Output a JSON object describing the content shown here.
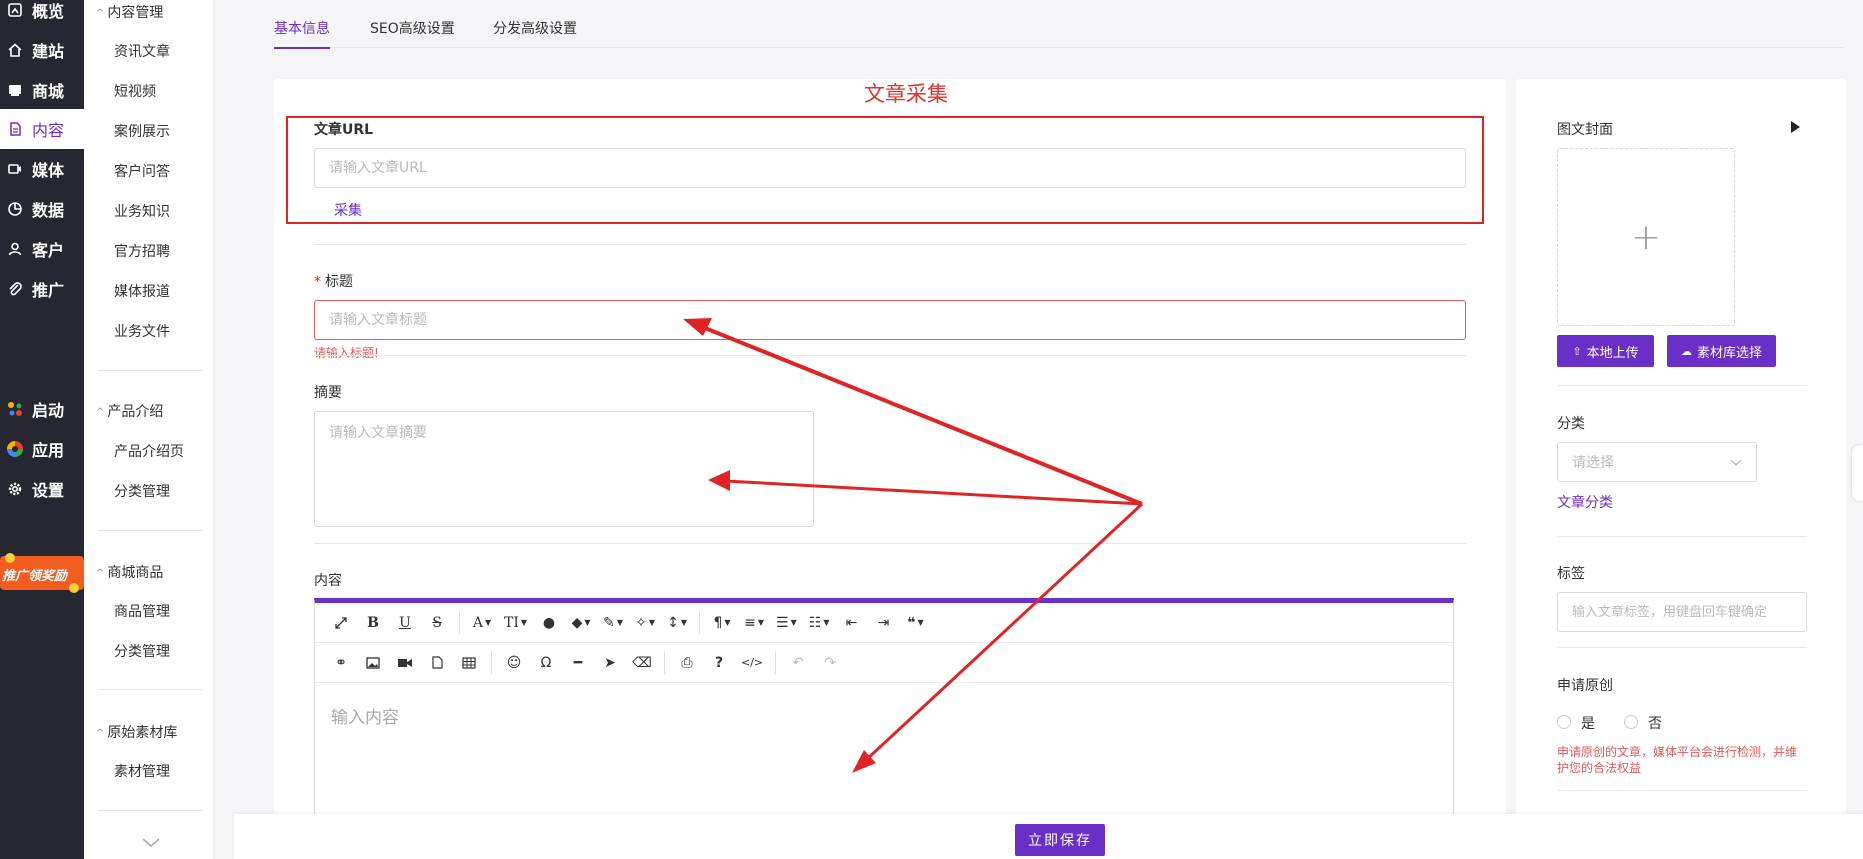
{
  "dark_nav": {
    "items": [
      {
        "label": "概览",
        "icon": "dashboard-icon"
      },
      {
        "label": "建站",
        "icon": "home-icon"
      },
      {
        "label": "商城",
        "icon": "shop-icon"
      },
      {
        "label": "内容",
        "icon": "document-icon",
        "active": true
      },
      {
        "label": "媒体",
        "icon": "video-icon"
      },
      {
        "label": "数据",
        "icon": "pie-chart-icon"
      },
      {
        "label": "客户",
        "icon": "user-icon"
      },
      {
        "label": "推广",
        "icon": "paperclip-icon"
      },
      {
        "label": "启动",
        "icon": "launch-icon"
      },
      {
        "label": "应用",
        "icon": "apps-icon"
      },
      {
        "label": "设置",
        "icon": "gear-icon"
      }
    ],
    "promo_text": "推广领奖励"
  },
  "sub_nav": {
    "groups": [
      {
        "title": "内容管理",
        "items": [
          "资讯文章",
          "短视频",
          "案例展示",
          "客户问答",
          "业务知识",
          "官方招聘",
          "媒体报道",
          "业务文件"
        ]
      },
      {
        "title": "产品介绍",
        "items": [
          "产品介绍页",
          "分类管理"
        ]
      },
      {
        "title": "商城商品",
        "items": [
          "商品管理",
          "分类管理"
        ]
      },
      {
        "title": "原始素材库",
        "items": [
          "素材管理"
        ]
      }
    ]
  },
  "tabs": [
    {
      "label": "基本信息",
      "active": true
    },
    {
      "label": "SEO高级设置"
    },
    {
      "label": "分发高级设置"
    }
  ],
  "form": {
    "section_title": "文章采集",
    "url_label": "文章URL",
    "url_placeholder": "请输入文章URL",
    "collect_link": "采集",
    "title_label": "标题",
    "title_placeholder": "请输入文章标题",
    "title_error": "请输入标题!",
    "summary_label": "摘要",
    "summary_placeholder": "请输入文章摘要",
    "content_label": "内容",
    "editor_placeholder": "输入内容"
  },
  "right_panel": {
    "cover_label": "图文封面",
    "upload_local": "本地上传",
    "library_select": "素材库选择",
    "category_label": "分类",
    "category_placeholder": "请选择",
    "category_link": "文章分类",
    "tags_label": "标签",
    "tags_placeholder": "输入文章标签，用键盘回车键确定",
    "original_label": "申请原创",
    "opt_yes": "是",
    "opt_no": "否",
    "original_note": "申请原创的文章，媒体平台会进行检测，并维护您的合法权益"
  },
  "bottom": {
    "save_label": "立即保存"
  },
  "colors": {
    "accent": "#6a2fc7",
    "annotation_red": "#e02424",
    "nav_dark": "#262730"
  }
}
